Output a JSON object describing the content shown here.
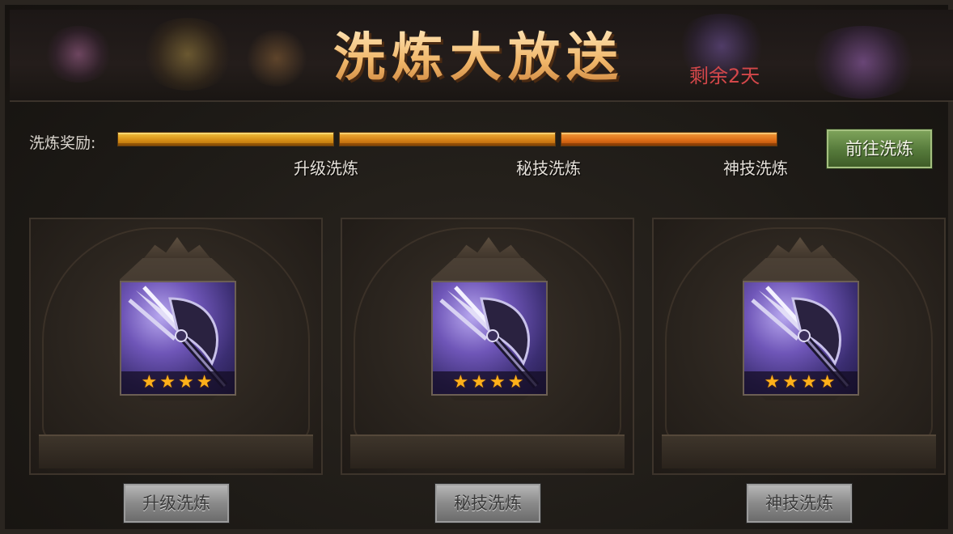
{
  "banner": {
    "title": "洗炼大放送",
    "remaining": "剩余2天"
  },
  "progress": {
    "label": "洗炼奖励:",
    "stages": [
      {
        "label": "升级洗炼",
        "fill": 1.0,
        "color": "#d58d15"
      },
      {
        "label": "秘技洗炼",
        "fill": 1.0,
        "color": "#d37f15"
      },
      {
        "label": "神技洗炼",
        "fill": 1.0,
        "color": "#db6b16"
      }
    ],
    "go_button": "前往洗炼"
  },
  "cards": [
    {
      "stars": "★★★★",
      "star_count": 4,
      "button": "升级洗炼",
      "icon": "trident-axe-icon"
    },
    {
      "stars": "★★★★",
      "star_count": 4,
      "button": "秘技洗炼",
      "icon": "trident-axe-icon"
    },
    {
      "stars": "★★★★",
      "star_count": 4,
      "button": "神技洗炼",
      "icon": "trident-axe-icon"
    }
  ],
  "colors": {
    "accent_gold": "#f0b669",
    "remaining_red": "#d3474a",
    "go_button_green": "#55793a",
    "item_purple": "#6f56b8"
  }
}
